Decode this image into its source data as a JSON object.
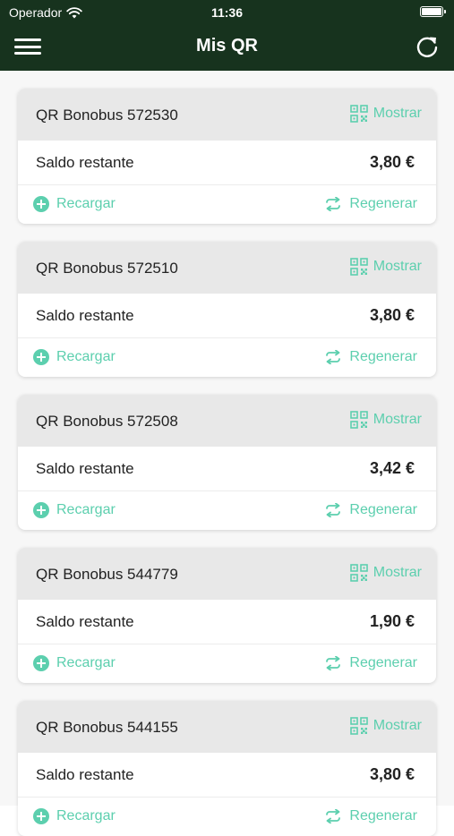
{
  "status_bar": {
    "carrier": "Operador",
    "time": "11:36"
  },
  "nav": {
    "title": "Mis QR"
  },
  "colors": {
    "header_bg": "#17331e",
    "accent": "#5ccfae",
    "card_head_bg": "#e8e8e8"
  },
  "icons": {
    "menu": "hamburger-icon",
    "refresh": "refresh-icon",
    "show": "qr-code-icon",
    "recharge": "plus-circle-icon",
    "regenerate": "swap-arrows-icon"
  },
  "cards": [
    {
      "name": "QR Bonobus 572530",
      "show_label": "Mostrar",
      "balance_label": "Saldo restante",
      "balance": "3,80 €",
      "recharge_label": "Recargar",
      "regenerate_label": "Regenerar"
    },
    {
      "name": "QR Bonobus 572510",
      "show_label": "Mostrar",
      "balance_label": "Saldo restante",
      "balance": "3,80 €",
      "recharge_label": "Recargar",
      "regenerate_label": "Regenerar"
    },
    {
      "name": "QR Bonobus 572508",
      "show_label": "Mostrar",
      "balance_label": "Saldo restante",
      "balance": "3,42 €",
      "recharge_label": "Recargar",
      "regenerate_label": "Regenerar"
    },
    {
      "name": "QR Bonobus 544779",
      "show_label": "Mostrar",
      "balance_label": "Saldo restante",
      "balance": "1,90 €",
      "recharge_label": "Recargar",
      "regenerate_label": "Regenerar"
    },
    {
      "name": "QR Bonobus 544155",
      "show_label": "Mostrar",
      "balance_label": "Saldo restante",
      "balance": "3,80 €",
      "recharge_label": "Recargar",
      "regenerate_label": "Regenerar"
    }
  ]
}
